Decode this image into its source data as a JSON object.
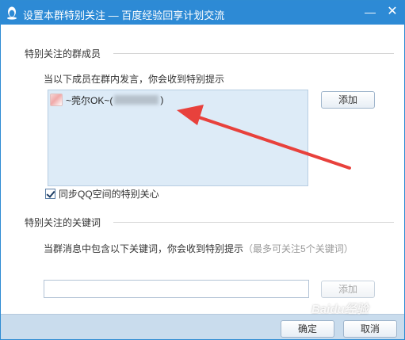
{
  "window": {
    "title": "设置本群特别关注 — 百度经验回享计划交流",
    "minimize_symbol": "—",
    "close_symbol": "✕"
  },
  "members_section": {
    "label": "特别关注的群成员",
    "hint": "当以下成员在群内发言，你会收到特别提示",
    "members": [
      {
        "name": "~莞尔OK~(",
        "name_suffix": ")"
      }
    ],
    "add_button": "添加"
  },
  "sync_option": {
    "label": "同步QQ空间的特别关心",
    "checked": true
  },
  "keywords_section": {
    "label": "特别关注的关键词",
    "hint": "当群消息中包含以下关键词，你会收到特别提示",
    "hint_muted": "（最多可关注5个关键词）",
    "input_value": "",
    "add_button": "添加"
  },
  "footer": {
    "ok_button": "确定",
    "cancel_button": "取消"
  },
  "watermark": "Baidu经验",
  "colors": {
    "titlebar": "#2d8ad5",
    "member_box": "#ddebf7",
    "footer": "#c9dced",
    "arrow": "#e8413c"
  }
}
